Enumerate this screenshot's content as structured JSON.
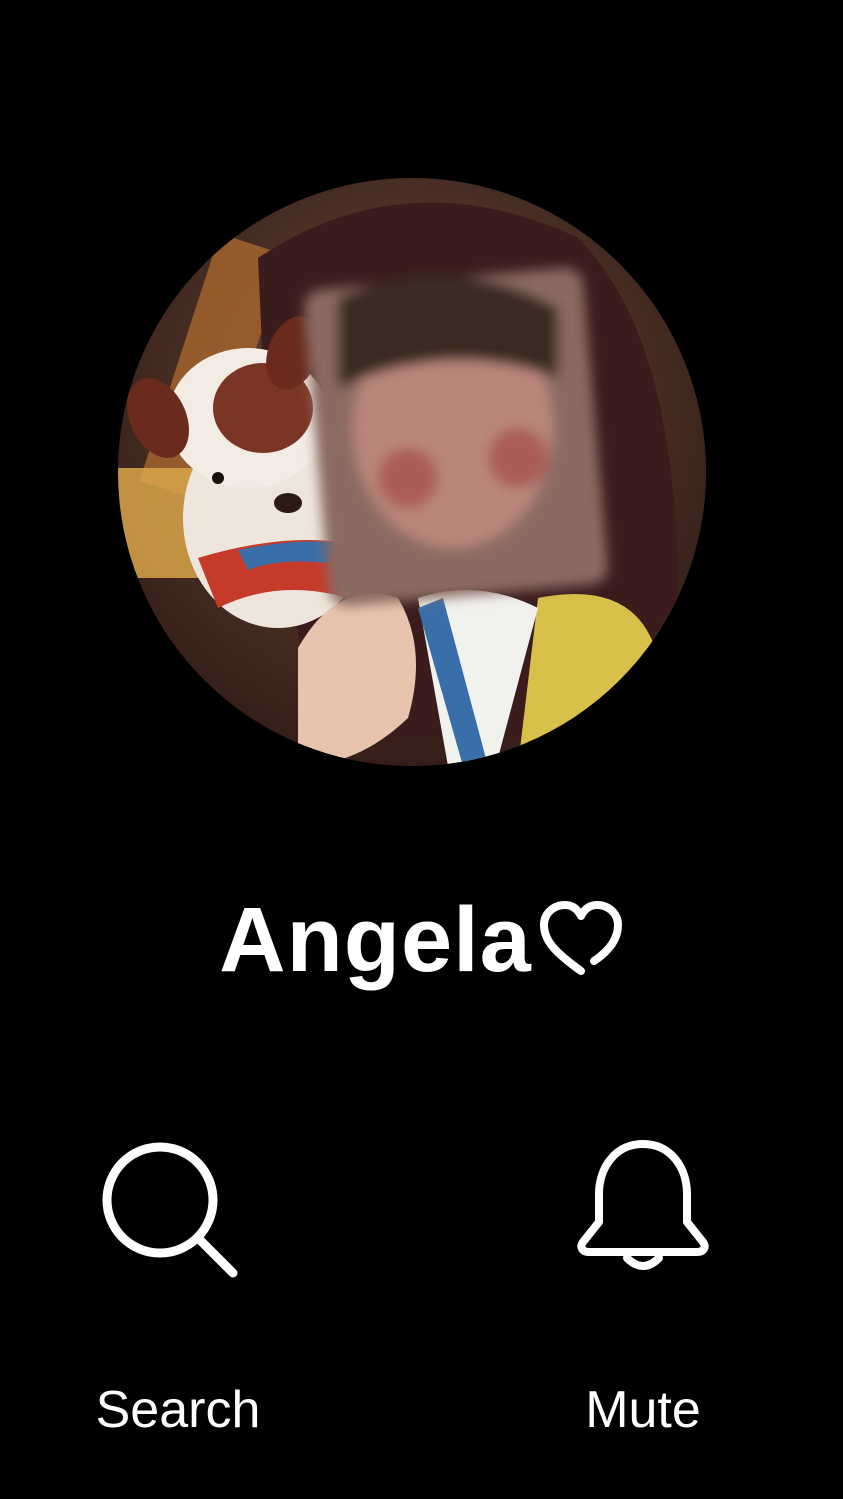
{
  "profile": {
    "name": "Angela",
    "name_suffix_icon": "heart-outline-icon"
  },
  "actions": [
    {
      "id": "search",
      "label": "Search",
      "icon": "search-icon"
    },
    {
      "id": "mute",
      "label": "Mute",
      "icon": "bell-icon"
    }
  ],
  "colors": {
    "background": "#000000",
    "text": "#ffffff"
  }
}
